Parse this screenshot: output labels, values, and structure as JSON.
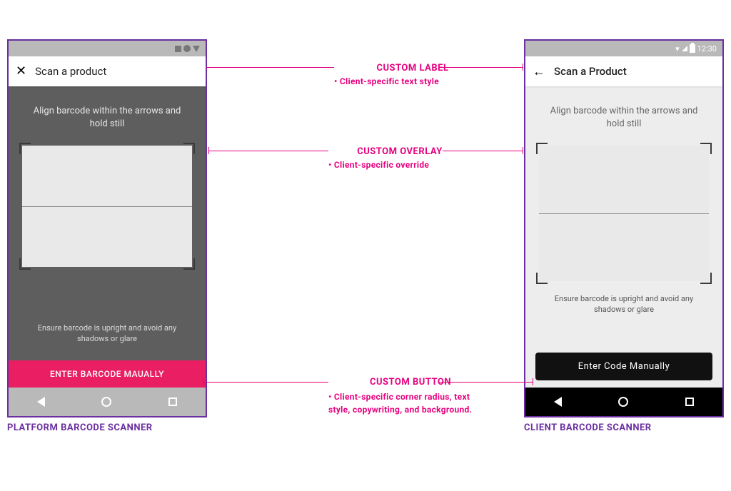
{
  "left_phone": {
    "title": "Scan a product",
    "instr_top": "Align barcode within the arrows and hold still",
    "instr_bottom": "Ensure barcode is upright and avoid any shadows or glare",
    "manual_button": "ENTER BARCODE MAUALLY"
  },
  "right_phone": {
    "time": "12:30",
    "title": "Scan a Product",
    "instr_top": "Align barcode within the arrows and hold still",
    "instr_bottom": "Ensure barcode is upright and avoid any shadows or glare",
    "manual_button": "Enter Code Manually"
  },
  "captions": {
    "left": "PLATFORM BARCODE SCANNER",
    "right": "CLIENT BARCODE SCANNER"
  },
  "annotations": {
    "label_title": "CUSTOM LABEL",
    "label_sub": "Client-specific text style",
    "overlay_title": "CUSTOM OVERLAY",
    "overlay_sub": "Client-specific override",
    "button_title": "CUSTOM BUTTON",
    "button_sub": "Client-specific corner radius, text style, copywriting, and background."
  }
}
